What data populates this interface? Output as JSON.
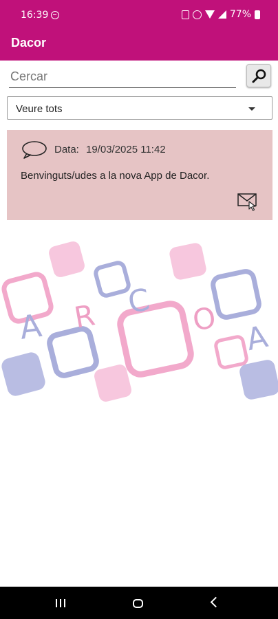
{
  "status_bar": {
    "time": "16:39",
    "battery": "77%"
  },
  "app_bar": {
    "title": "Dacor"
  },
  "search": {
    "placeholder": "Cercar"
  },
  "filter": {
    "selected": "Veure tots"
  },
  "message": {
    "date_label": "Data:",
    "date_value": "19/03/2025 11:42",
    "text": "Benvinguts/udes a la nova App de Dacor."
  },
  "logo": {
    "letters": [
      "A",
      "R",
      "C",
      "O",
      "A"
    ],
    "colors": {
      "pink": "#f2b8d4",
      "pink_outline": "#ee9fc4",
      "lavender": "#a9aedb",
      "lavender_dark": "#8f95cc"
    }
  },
  "theme": {
    "primary": "#c0117a",
    "card_background": "#e6c4c5"
  }
}
